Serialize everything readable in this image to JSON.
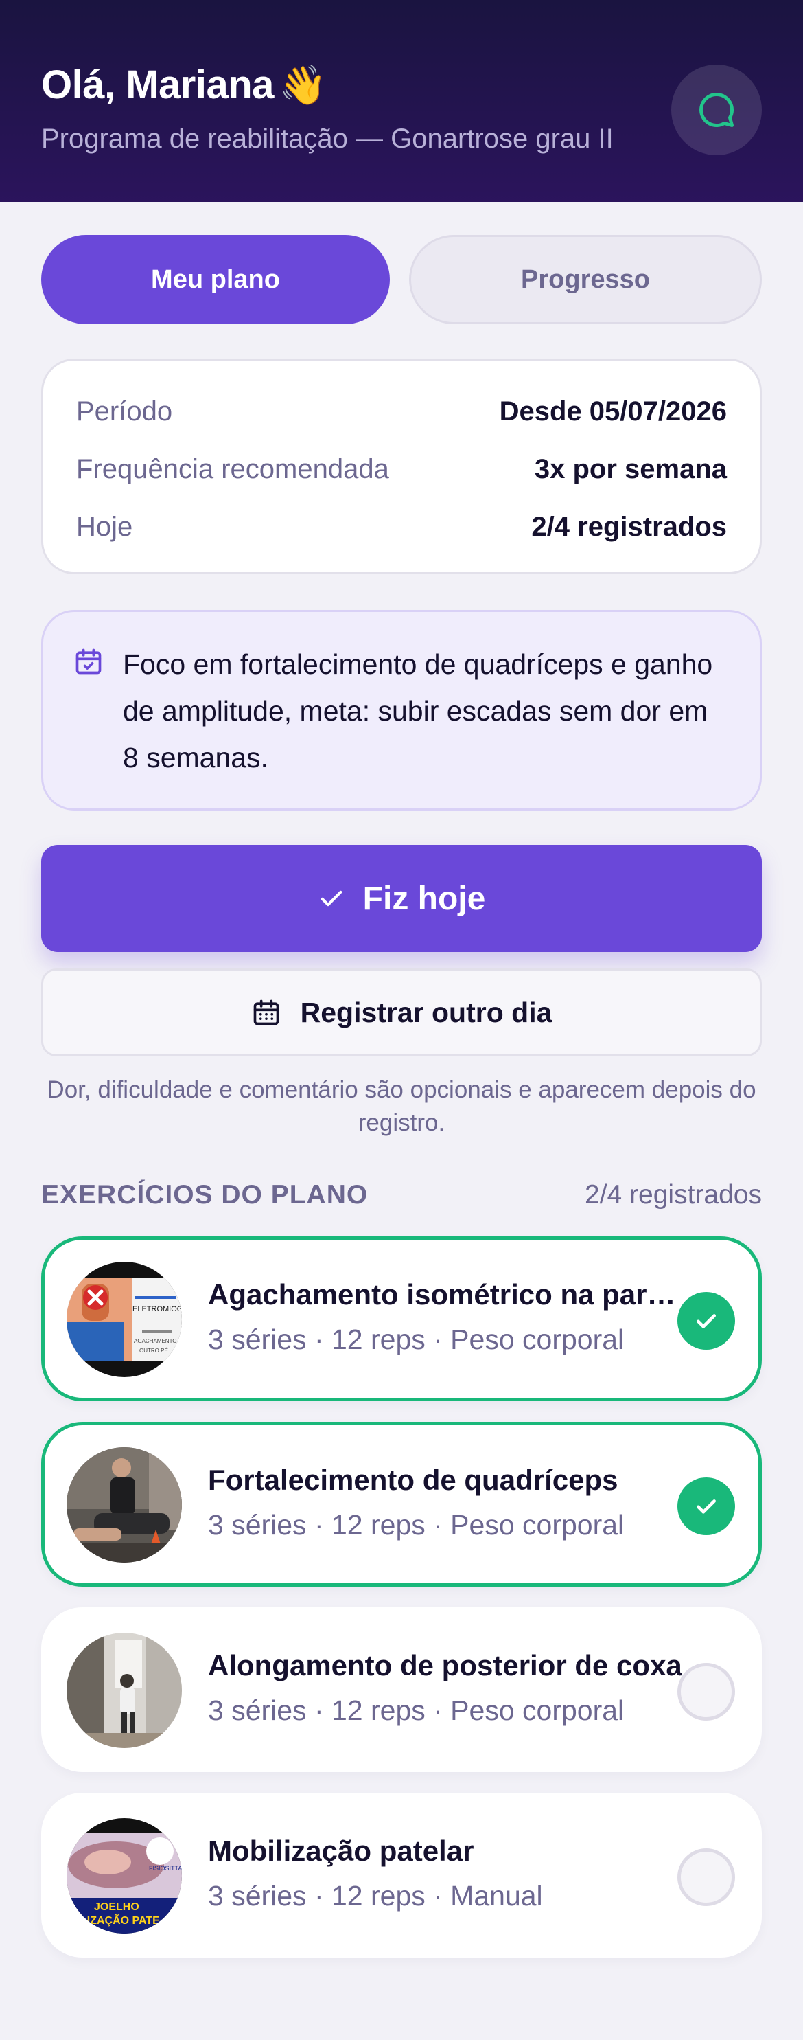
{
  "header": {
    "greeting": "Olá, Mariana",
    "wave_emoji": "👋",
    "subtitle": "Programa de reabilitação — Gonartrose grau II",
    "chat_icon": "chat-bubble-icon",
    "accent": "#22c58b"
  },
  "tabs": [
    {
      "label": "Meu plano",
      "active": true
    },
    {
      "label": "Progresso",
      "active": false
    }
  ],
  "info": [
    {
      "key": "Período",
      "value": "Desde 05/07/2026"
    },
    {
      "key": "Frequência recomendada",
      "value": "3x por semana"
    },
    {
      "key": "Hoje",
      "value": "2/4 registrados"
    }
  ],
  "focus": {
    "icon": "calendar-check-icon",
    "text": "Foco em fortalecimento de quadríceps e ganho de amplitude, meta: subir escadas sem dor em 8 semanas."
  },
  "actions": {
    "primary_label": "Fiz hoje",
    "primary_icon": "check-icon",
    "secondary_label": "Registrar outro dia",
    "secondary_icon": "calendar-icon",
    "hint": "Dor, dificuldade e comentário são opcionais e aparecem depois do registro."
  },
  "exercises_section": {
    "title": "EXERCÍCIOS DO PLANO",
    "count": "2/4 registrados"
  },
  "exercises": [
    {
      "title": "Agachamento isométrico na parede",
      "meta": "3 séries · 12 reps · Peso corporal",
      "done": true
    },
    {
      "title": "Fortalecimento de quadríceps",
      "meta": "3 séries · 12 reps · Peso corporal",
      "done": true
    },
    {
      "title": "Alongamento de posterior de coxa",
      "meta": "3 séries · 12 reps · Peso corporal",
      "done": false
    },
    {
      "title": "Mobilização patelar",
      "meta": "3 séries · 12 reps · Manual",
      "done": false
    }
  ],
  "thumb_labels": {
    "ex1_a": "ELETROMIOG",
    "ex1_b": "AGACHAMENTO NA",
    "ex1_c": "OUTRO PÉ",
    "ex4_a": "FISIOSITTA.COM",
    "ex4_b": "JOELHO",
    "ex4_c": "BILIZAÇÃO PATE"
  },
  "colors": {
    "primary": "#6a48d9",
    "done_green": "#19b87a",
    "header_dark": "#1a1440"
  }
}
